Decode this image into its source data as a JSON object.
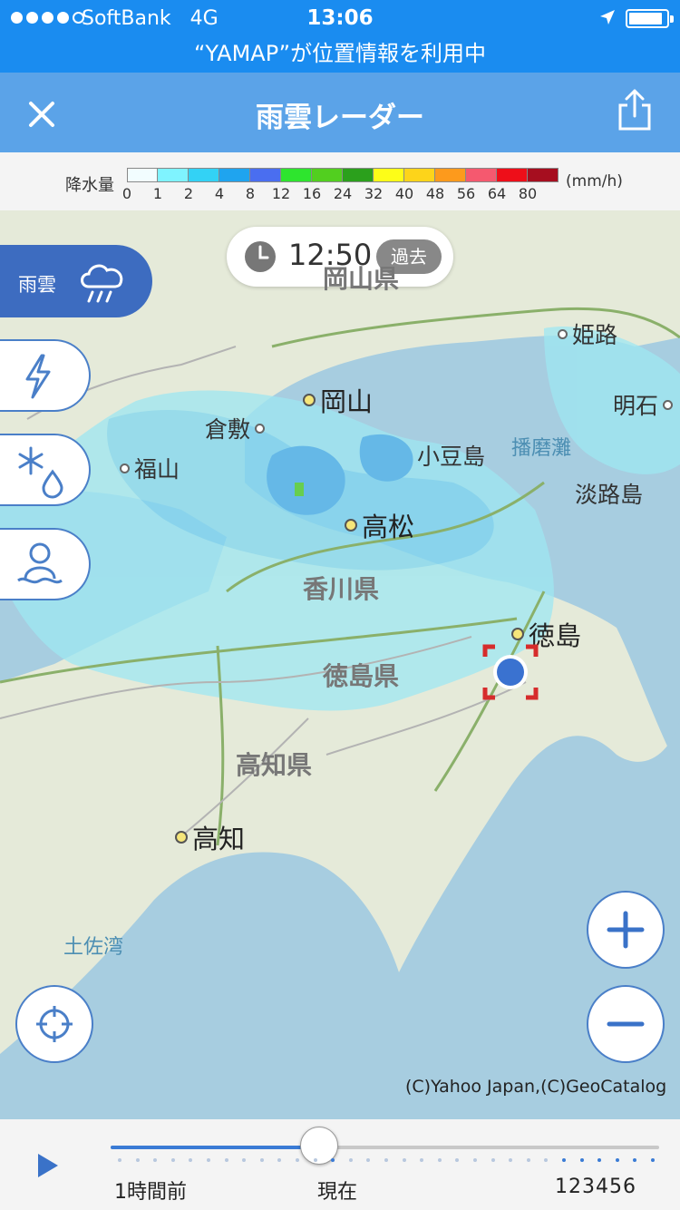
{
  "status_bar": {
    "carrier": "SoftBank",
    "network": "4G",
    "time": "13:06",
    "signal_bars": 4,
    "signal_max": 5,
    "location_icon": "location-arrow-icon",
    "battery_icon": "battery-icon"
  },
  "location_banner": "“YAMAP”が位置情報を利用中",
  "header": {
    "title": "雨雲レーダー",
    "close_icon": "close-icon",
    "share_icon": "share-icon",
    "bg_color": "#5ba3e8"
  },
  "legend": {
    "label": "降水量",
    "unit": "(mm/h)",
    "ticks": [
      "0",
      "1",
      "2",
      "4",
      "8",
      "12",
      "16",
      "24",
      "32",
      "40",
      "48",
      "56",
      "64",
      "80"
    ],
    "colors": [
      "#f2fdff",
      "#7ff3ff",
      "#33d2f5",
      "#1fa4ef",
      "#4a6ef0",
      "#2ee52e",
      "#52cf1f",
      "#2ba01c",
      "#fdfd18",
      "#fdd41a",
      "#fd9a1c",
      "#f5596f",
      "#ee0e19",
      "#a60e1f"
    ]
  },
  "time_overlay": {
    "time": "12:50",
    "badge": "過去",
    "icon": "clock-icon"
  },
  "side_tabs": [
    {
      "label": "雨雲",
      "icon": "rain-cloud-icon",
      "active": true
    },
    {
      "label": "",
      "icon": "lightning-icon",
      "active": false
    },
    {
      "label": "",
      "icon": "snow-rain-icon",
      "active": false
    },
    {
      "label": "",
      "icon": "snowman-icon",
      "active": false
    }
  ],
  "map": {
    "cities": {
      "himeji": "姫路",
      "akashi": "明石",
      "okayama": "岡山",
      "kurashiki": "倉敷",
      "fukuyama": "福山",
      "shodoshima": "小豆島",
      "awajishima": "淡路島",
      "takamatsu": "高松",
      "tokushima": "徳島",
      "kochi": "高知"
    },
    "prefectures": {
      "kagawa": "香川県",
      "tokushima": "徳島県",
      "kochi": "高知県",
      "okayama_partial": "岡山県"
    },
    "seas": {
      "harimanada": "播磨灘",
      "tosawan": "土佐湾"
    },
    "copyright": "(C)Yahoo Japan,(C)GeoCatalog",
    "zoom_in_icon": "plus-icon",
    "zoom_out_icon": "minus-icon",
    "locate_icon": "crosshair-icon"
  },
  "timeline": {
    "play_icon": "play-icon",
    "label_past": "1時間前",
    "label_now": "現在",
    "label_future": "123456",
    "progress": 0.38
  }
}
